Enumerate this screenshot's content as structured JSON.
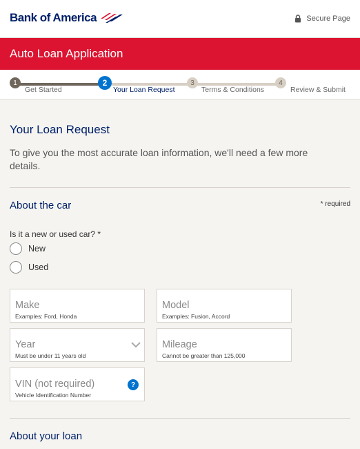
{
  "header": {
    "logo_text": "Bank of America",
    "secure_label": "Secure Page"
  },
  "banner": {
    "title": "Auto Loan Application"
  },
  "steps": [
    {
      "number": "1",
      "label": "Get Started",
      "state": "done"
    },
    {
      "number": "2",
      "label": "Your Loan Request",
      "state": "current"
    },
    {
      "number": "3",
      "label": "Terms & Conditions",
      "state": "todo"
    },
    {
      "number": "4",
      "label": "Review & Submit",
      "state": "todo"
    }
  ],
  "main": {
    "heading": "Your Loan Request",
    "intro": "To give you the most accurate loan information, we'll need a few more details.",
    "car_section": {
      "heading": "About the car",
      "required_note": "* required",
      "question": "Is it a new or used car? *",
      "options": [
        "New",
        "Used"
      ]
    },
    "fields": {
      "make": {
        "label": "Make",
        "hint": "Examples: Ford, Honda"
      },
      "model": {
        "label": "Model",
        "hint": "Examples: Fusion, Accord"
      },
      "year": {
        "label": "Year",
        "hint": "Must be under 11 years old"
      },
      "mileage": {
        "label": "Mileage",
        "hint": "Cannot be greater than 125,000"
      },
      "vin": {
        "label": "VIN (not required)",
        "hint": "Vehicle Identification Number",
        "help_icon": "?"
      }
    },
    "loan_section": {
      "heading": "About your loan"
    }
  },
  "colors": {
    "brand_navy": "#012169",
    "brand_red": "#dc1431",
    "step_active": "#0073cf"
  }
}
